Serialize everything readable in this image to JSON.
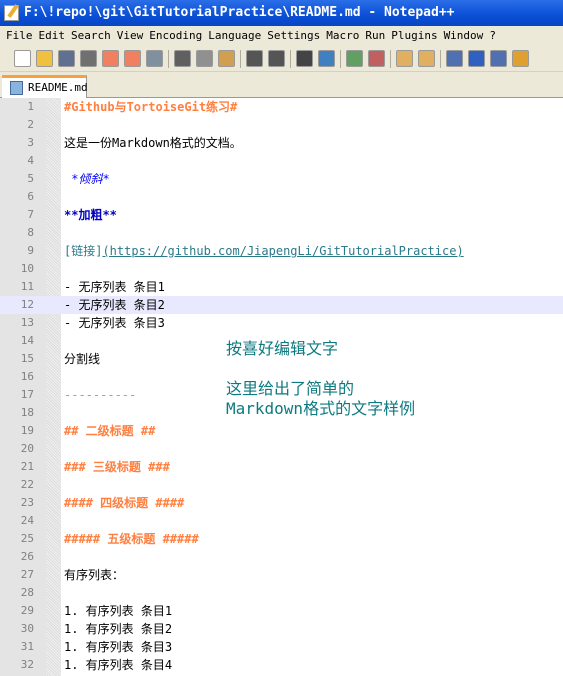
{
  "window": {
    "title": "F:\\!repo!\\git\\GitTutorialPractice\\README.md - Notepad++"
  },
  "menu": [
    "File",
    "Edit",
    "Search",
    "View",
    "Encoding",
    "Language",
    "Settings",
    "Macro",
    "Run",
    "Plugins",
    "Window",
    "?"
  ],
  "toolbar": {
    "icons": [
      "new-file",
      "open",
      "save",
      "save-all",
      "close",
      "close-all",
      "print",
      "cut",
      "copy",
      "paste",
      "undo",
      "redo",
      "find",
      "replace",
      "zoom-in",
      "zoom-out",
      "sync-v",
      "sync-h",
      "word-wrap",
      "show-all-chars",
      "indent-guide",
      "user-lang"
    ]
  },
  "tab": {
    "label": "README.md"
  },
  "lines": [
    {
      "n": "1",
      "t": "#Github与TortoiseGit练习#",
      "s": "h"
    },
    {
      "n": "2",
      "t": "",
      "s": "pl"
    },
    {
      "n": "3",
      "t": "这是一份Markdown格式的文档。",
      "s": "pl"
    },
    {
      "n": "4",
      "t": "",
      "s": "pl"
    },
    {
      "n": "5",
      "t": " *倾斜*",
      "s": "it"
    },
    {
      "n": "6",
      "t": "",
      "s": "pl"
    },
    {
      "n": "7",
      "t": "**加粗**",
      "s": "bd"
    },
    {
      "n": "8",
      "t": "",
      "s": "pl"
    },
    {
      "n": "9",
      "t": "[链接]",
      "s": "lk",
      "t2": "(https://github.com/JiapengLi/GitTutorialPractice)"
    },
    {
      "n": "10",
      "t": "",
      "s": "pl"
    },
    {
      "n": "11",
      "t": "- 无序列表 条目1",
      "s": "pl"
    },
    {
      "n": "12",
      "t": "- 无序列表 条目2",
      "s": "pl"
    },
    {
      "n": "13",
      "t": "- 无序列表 条目3",
      "s": "pl"
    },
    {
      "n": "14",
      "t": "",
      "s": "pl"
    },
    {
      "n": "15",
      "t": "分割线",
      "s": "pl"
    },
    {
      "n": "16",
      "t": "",
      "s": "pl"
    },
    {
      "n": "17",
      "t": "----------",
      "s": "hr"
    },
    {
      "n": "18",
      "t": "",
      "s": "pl"
    },
    {
      "n": "19",
      "t": "## 二级标题 ##",
      "s": "h"
    },
    {
      "n": "20",
      "t": "",
      "s": "pl"
    },
    {
      "n": "21",
      "t": "### 三级标题 ###",
      "s": "h"
    },
    {
      "n": "22",
      "t": "",
      "s": "pl"
    },
    {
      "n": "23",
      "t": "#### 四级标题 ####",
      "s": "h"
    },
    {
      "n": "24",
      "t": "",
      "s": "pl"
    },
    {
      "n": "25",
      "t": "##### 五级标题 #####",
      "s": "h"
    },
    {
      "n": "26",
      "t": "",
      "s": "pl"
    },
    {
      "n": "27",
      "t": "有序列表：",
      "s": "pl"
    },
    {
      "n": "28",
      "t": "",
      "s": "pl"
    },
    {
      "n": "29",
      "t": "1. 有序列表 条目1",
      "s": "pl"
    },
    {
      "n": "30",
      "t": "1. 有序列表 条目2",
      "s": "pl"
    },
    {
      "n": "31",
      "t": "1. 有序列表 条目3",
      "s": "pl"
    },
    {
      "n": "32",
      "t": "1. 有序列表 条目4",
      "s": "pl"
    }
  ],
  "current_line": "12",
  "notes": {
    "note1": "按喜好编辑文字",
    "note2a": "这里给出了简单的",
    "note2b": "Markdown格式的文字样例"
  },
  "colors": {
    "heading": "#ff8040",
    "note": "#0d7a80",
    "current_line": "#e8e8ff"
  }
}
